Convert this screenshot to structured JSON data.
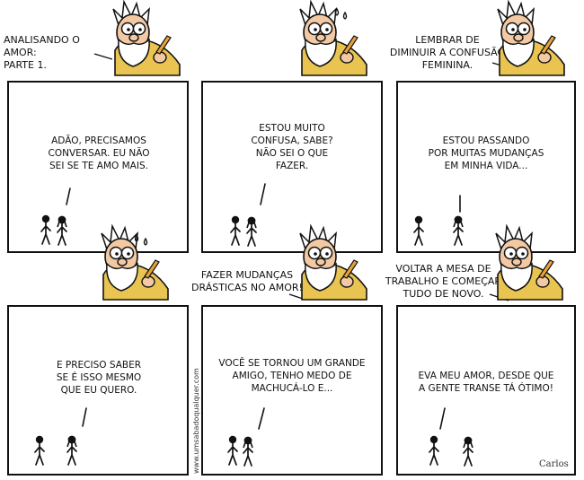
{
  "panels": [
    {
      "caption": "ANALISANDO O AMOR:\nPARTE 1.",
      "speech": "ADÃO, PRECISAMOS\nCONVERSAR. EU NÃO\nSEI SE TE AMO MAIS."
    },
    {
      "caption": "",
      "speech": "ESTOU MUITO\nCONFUSA, SABE?\nNÃO SEI O QUE\nFAZER."
    },
    {
      "caption": "LEMBRAR DE\nDIMINUIR A CONFUSÃO\nFEMININA.",
      "speech": "ESTOU PASSANDO\nPOR MUITAS MUDANÇAS\nEM MINHA VIDA..."
    },
    {
      "caption": "",
      "speech": "E PRECISO SABER\nSE É ISSO MESMO\nQUE EU QUERO."
    },
    {
      "caption": "FAZER MUDANÇAS\nDRÁSTICAS NO AMOR!",
      "speech": "VOCÊ SE TORNOU UM GRANDE\nAMIGO, TENHO MEDO DE\nMACHUCÁ-LO E..."
    },
    {
      "caption": "VOLTAR A MESA DE\nTRABALHO E COMEÇAR\nTUDO DE NOVO.",
      "speech": "EVA MEU AMOR, DESDE QUE\nA GENTE TRANSE TÁ ÓTIMO!"
    }
  ],
  "credit": "www.umsabadoqualquer.com",
  "signature": "Carlos",
  "colors": {
    "robe": "#e9c451",
    "skin": "#f3c9a4",
    "beard": "#ffffff",
    "outline": "#111111"
  }
}
